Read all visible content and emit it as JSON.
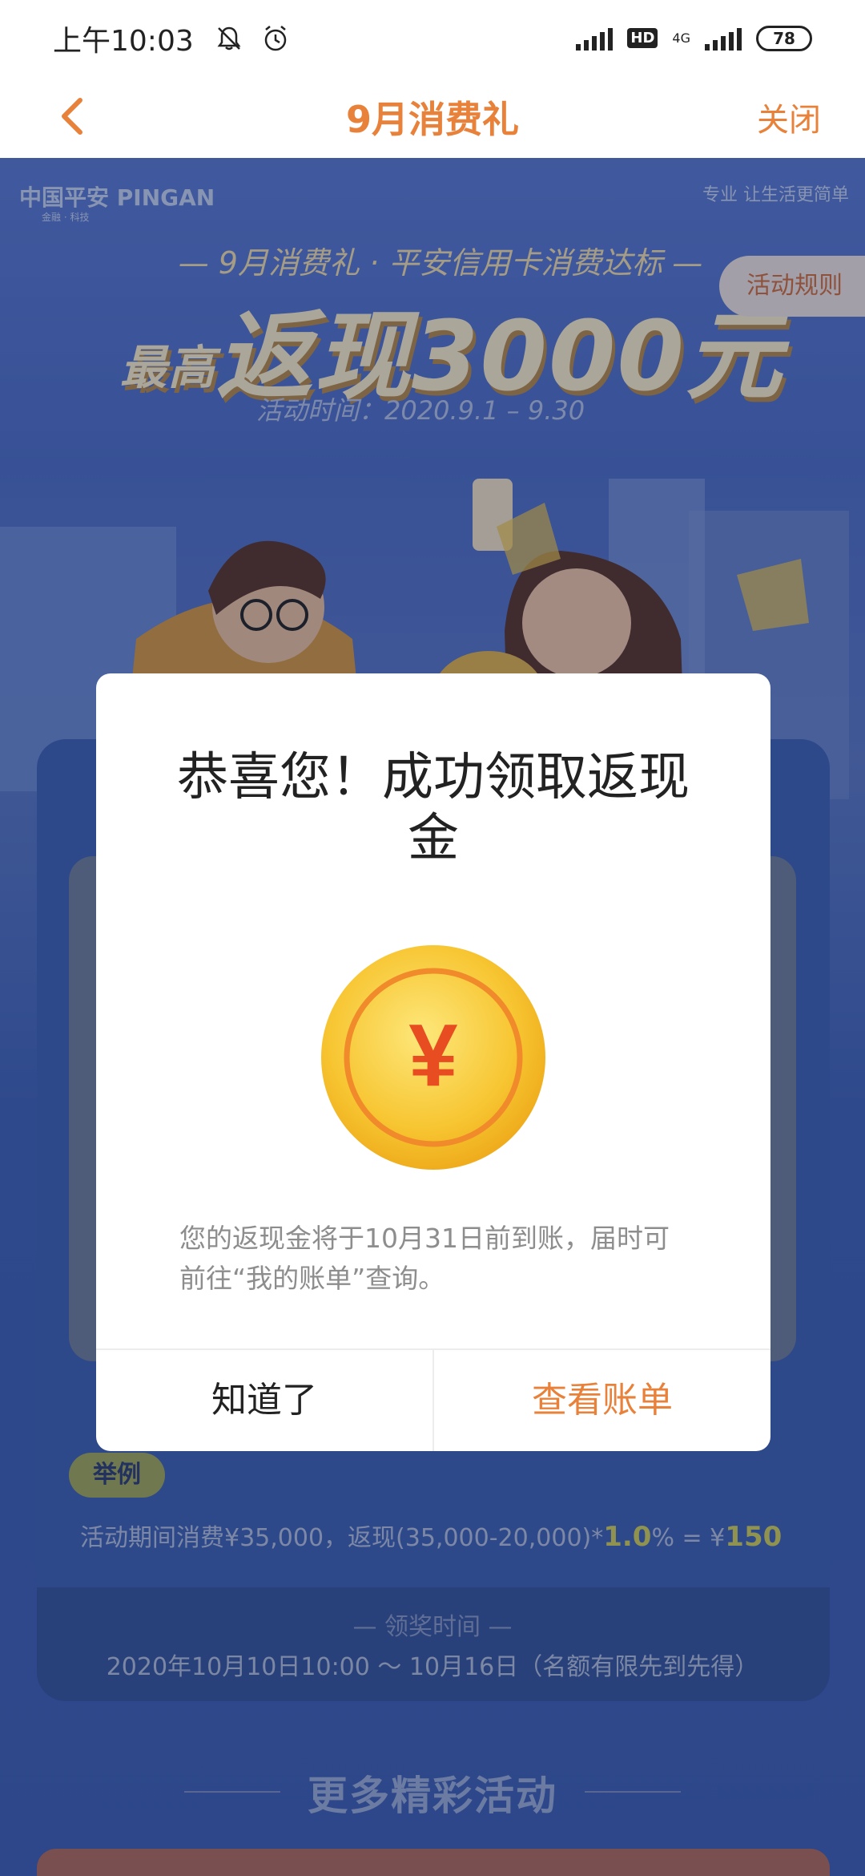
{
  "status_bar": {
    "time": "上午10:03",
    "hd": "HD",
    "network": "4G",
    "battery": "78"
  },
  "nav": {
    "title": "9月消费礼",
    "close": "关闭"
  },
  "banner": {
    "bank_logo": "中国平安 PINGAN",
    "bank_sub": "金融 · 科技",
    "slogan": "专业 让生活更简单",
    "subtitle": "— 9月消费礼 · 平安信用卡消费达标 —",
    "headline_prefix": "最高",
    "headline_main": "返现3000元",
    "date": "活动时间：2020.9.1 – 9.30",
    "rules_button": "活动规则"
  },
  "content": {
    "example_label": "举例",
    "example_text_1": "活动期间消费¥35,000，返现(35,000-20,000)*",
    "example_rate": "1.0",
    "example_text_2": "% = ¥",
    "example_result": "150",
    "award_label": "— 领奖时间 —",
    "award_time": "2020年10月10日10:00 ～ 10月16日（名额有限先到先得）",
    "more_title": "更多精彩活动"
  },
  "modal": {
    "title": "恭喜您！成功领取返现金",
    "coin_symbol": "¥",
    "description": "您的返现金将于10月31日前到账，届时可前往“我的账单”查询。",
    "ok_button": "知道了",
    "view_bill_button": "查看账单"
  },
  "colors": {
    "accent": "#e8813a",
    "banner_blue": "#4e6ec9",
    "coin_gold": "#f7c531"
  }
}
